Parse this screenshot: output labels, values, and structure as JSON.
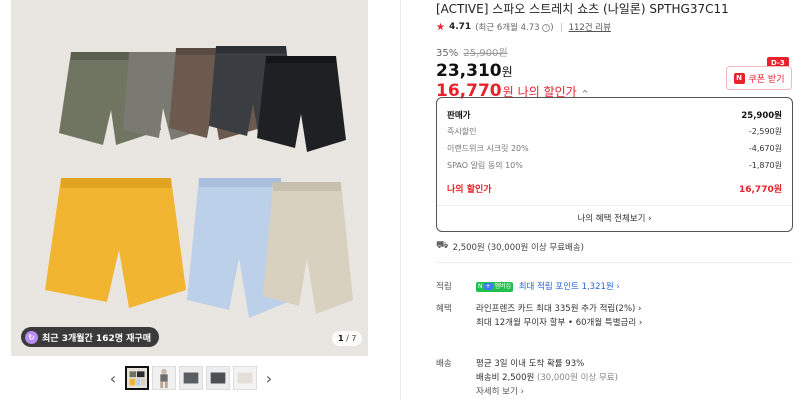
{
  "product": {
    "title": "[ACTIVE] 스파오 스트레치 쇼츠 (나일론) SPTHG37C11",
    "rating": "4.71",
    "recent_rating": "(최근 6개월 4.73",
    "review_count": "112건 리뷰"
  },
  "price": {
    "discount_rate": "35%",
    "original_price": "25,900원",
    "sale_price": "23,310",
    "sale_unit": "원",
    "my_price": "16,770",
    "my_unit": "원",
    "my_label": "나의 할인가",
    "caret": "^"
  },
  "coupon": {
    "label": "쿠폰 받기",
    "dday": "D-3",
    "icon": "N"
  },
  "price_breakdown": {
    "rows": [
      {
        "label": "판매가",
        "value": "25,900원"
      },
      {
        "label": "즉시할인",
        "value": "-2,590원"
      },
      {
        "label": "이랜드위크 시크릿 20%",
        "value": "-4,670원"
      },
      {
        "label": "SPAO 알림 동의 10%",
        "value": "-1,870원"
      }
    ],
    "my_label": "나의 할인가",
    "my_value": "16,770원",
    "benefits_link": "나의 혜택 전체보기 ›"
  },
  "shipping": {
    "icon": "truck-icon",
    "summary": "2,500원 (30,000원 이상 무료배송)"
  },
  "points": {
    "label": "적립",
    "tag_n": "N",
    "tag_pay": "+",
    "tag_text": "멤버십",
    "text": "최대 적립 포인트 1,321원 ›"
  },
  "benefits": {
    "label": "혜택",
    "line1": "라인프렌즈 카드 최대 335원 추가 적립(2%) ›",
    "line2": "최대 12개월 무이자 할부 • 60개월 특별금리 ›"
  },
  "delivery": {
    "label": "배송",
    "line1": "평균 3일 이내 도착 확률 93%",
    "fee": "배송비 2,500원",
    "fee_note": "(30,000원 이상 무료)",
    "more": "자세히 보기 ›"
  },
  "gallery": {
    "badge_text": "최근 3개월간 162명 재구매",
    "counter_current": "1",
    "counter_total": "/ 7",
    "prev_icon": "‹",
    "next_icon": "›"
  },
  "colors": {
    "accent_red": "#e8222d",
    "points_green": "#20c04b",
    "link_blue": "#2866d8"
  }
}
